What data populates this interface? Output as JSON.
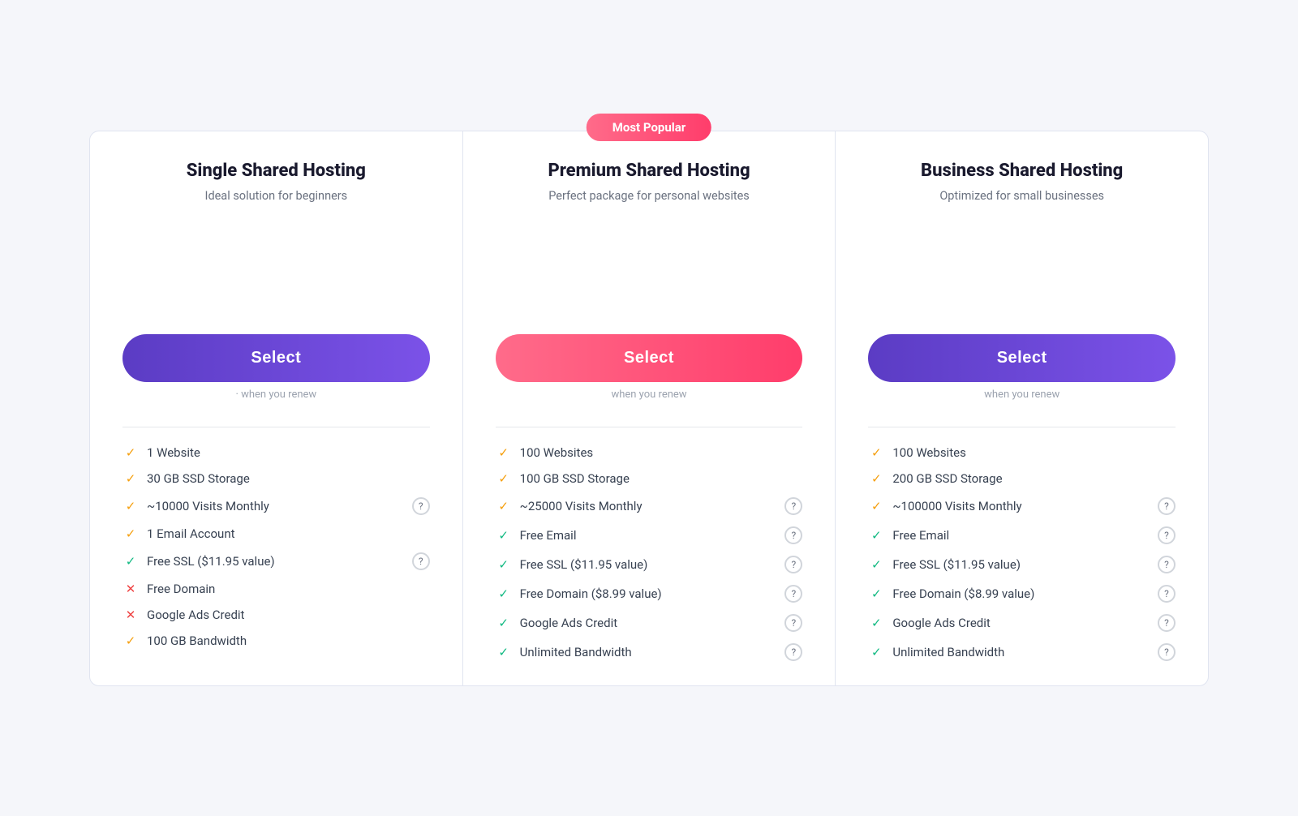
{
  "plans": [
    {
      "id": "single",
      "title": "Single Shared Hosting",
      "subtitle": "Ideal solution for beginners",
      "popular": false,
      "selectLabel": "Select",
      "selectStyle": "purple",
      "renewText": "· when you renew",
      "features": [
        {
          "icon": "check-orange",
          "text": "1 Website",
          "hasHelp": false
        },
        {
          "icon": "check-orange",
          "text": "30 GB SSD Storage",
          "hasHelp": false
        },
        {
          "icon": "check-orange",
          "text": "~10000 Visits Monthly",
          "hasHelp": true
        },
        {
          "icon": "check-orange",
          "text": "1 Email Account",
          "hasHelp": false
        },
        {
          "icon": "check-green",
          "text": "Free SSL ($11.95 value)",
          "hasHelp": true
        },
        {
          "icon": "cross",
          "text": "Free Domain",
          "hasHelp": false
        },
        {
          "icon": "cross",
          "text": "Google Ads Credit",
          "hasHelp": false
        },
        {
          "icon": "check-orange",
          "text": "100 GB Bandwidth",
          "hasHelp": false
        }
      ]
    },
    {
      "id": "premium",
      "title": "Premium Shared Hosting",
      "subtitle": "Perfect package for personal websites",
      "popular": true,
      "popularLabel": "Most Popular",
      "selectLabel": "Select",
      "selectStyle": "pink",
      "renewText": "when you renew",
      "features": [
        {
          "icon": "check-orange",
          "text": "100 Websites",
          "hasHelp": false
        },
        {
          "icon": "check-orange",
          "text": "100 GB SSD Storage",
          "hasHelp": false
        },
        {
          "icon": "check-orange",
          "text": "~25000 Visits Monthly",
          "hasHelp": true
        },
        {
          "icon": "check-green",
          "text": "Free Email",
          "hasHelp": true
        },
        {
          "icon": "check-green",
          "text": "Free SSL ($11.95 value)",
          "hasHelp": true
        },
        {
          "icon": "check-green",
          "text": "Free Domain ($8.99 value)",
          "hasHelp": true
        },
        {
          "icon": "check-green",
          "text": "Google Ads Credit",
          "hasHelp": true
        },
        {
          "icon": "check-green",
          "text": "Unlimited Bandwidth",
          "hasHelp": true
        }
      ]
    },
    {
      "id": "business",
      "title": "Business Shared Hosting",
      "subtitle": "Optimized for small businesses",
      "popular": false,
      "selectLabel": "Select",
      "selectStyle": "purple",
      "renewText": "when you renew",
      "features": [
        {
          "icon": "check-orange",
          "text": "100 Websites",
          "hasHelp": false
        },
        {
          "icon": "check-orange",
          "text": "200 GB SSD Storage",
          "hasHelp": false
        },
        {
          "icon": "check-orange",
          "text": "~100000 Visits Monthly",
          "hasHelp": true
        },
        {
          "icon": "check-green",
          "text": "Free Email",
          "hasHelp": true
        },
        {
          "icon": "check-green",
          "text": "Free SSL ($11.95 value)",
          "hasHelp": true
        },
        {
          "icon": "check-green",
          "text": "Free Domain ($8.99 value)",
          "hasHelp": true
        },
        {
          "icon": "check-green",
          "text": "Google Ads Credit",
          "hasHelp": true
        },
        {
          "icon": "check-green",
          "text": "Unlimited Bandwidth",
          "hasHelp": true
        }
      ]
    }
  ],
  "icons": {
    "check-orange": "✓",
    "check-green": "✓",
    "cross": "✕",
    "help": "?"
  }
}
